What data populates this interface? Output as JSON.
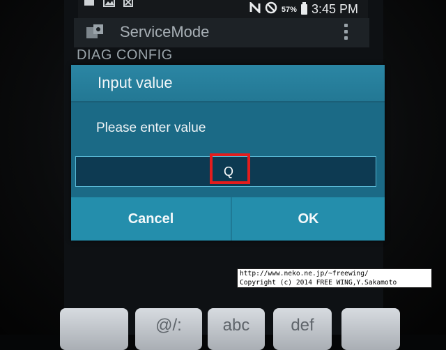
{
  "status_bar": {
    "battery_percent": "57%",
    "time": "3:45 PM"
  },
  "action_bar": {
    "title": "ServiceMode"
  },
  "screen": {
    "section_label": "DIAG CONFIG"
  },
  "dialog": {
    "title": "Input value",
    "message": "Please enter value",
    "input_value": "Q",
    "cancel_label": "Cancel",
    "ok_label": "OK"
  },
  "keyboard": {
    "keys": [
      "",
      "@/:",
      "abc",
      "def",
      ""
    ]
  },
  "watermark": {
    "line1": "http://www.neko.ne.jp/~freewing/",
    "line2": "Copyright (c) 2014 FREE WING,Y.Sakamoto"
  },
  "colors": {
    "dialog_bg": "#1b6a86",
    "button_bg": "#248eac",
    "highlight": "#e41d1d"
  }
}
